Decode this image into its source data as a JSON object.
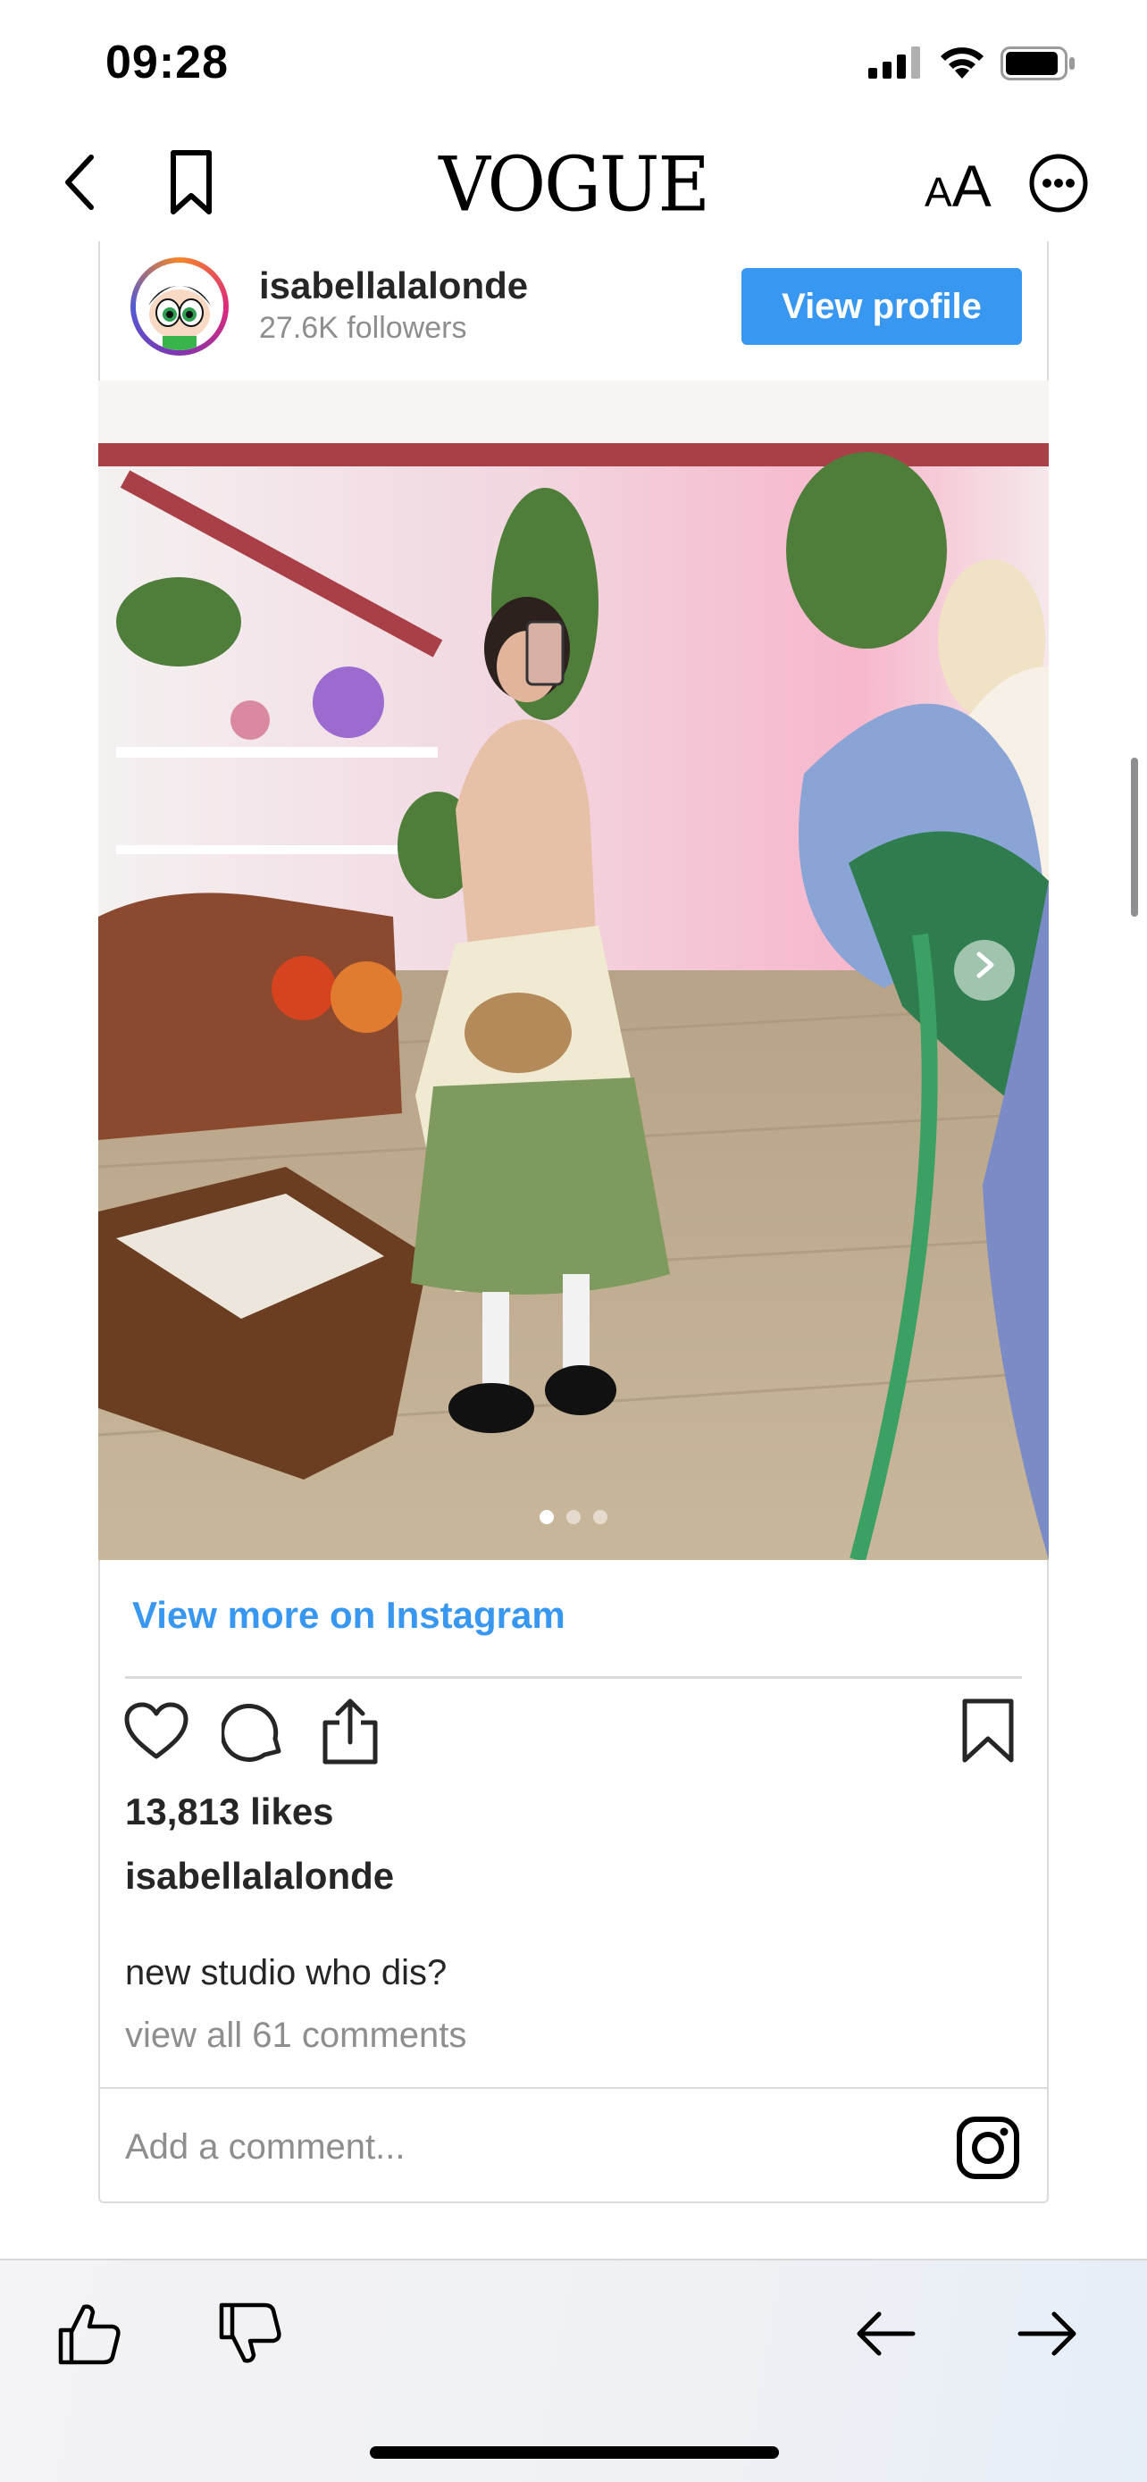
{
  "status_bar": {
    "time": "09:28"
  },
  "nav": {
    "brand": "VOGUE",
    "text_size_small": "A",
    "text_size_big": "A"
  },
  "embed": {
    "username": "isabellalalonde",
    "followers": "27.6K followers",
    "view_profile_label": "View profile",
    "view_more_label": "View more on Instagram",
    "likes": "13,813 likes",
    "caption_user": "isabellalalonde",
    "caption_text": "new studio who dis?",
    "view_comments": "view all 61 comments",
    "comment_placeholder": "Add a comment...",
    "carousel": {
      "count": 3,
      "active": 1
    }
  },
  "colors": {
    "accent": "#3897f0",
    "muted": "#8e8e8e",
    "text": "#262626",
    "border": "#dbdbdb"
  },
  "icons": {
    "nav": [
      "back-icon",
      "bookmark-icon",
      "text-size-icon",
      "more-icon"
    ],
    "post_actions": [
      "heart-icon",
      "comment-icon",
      "share-icon",
      "save-icon"
    ],
    "toolbar": [
      "thumbs-up-icon",
      "thumbs-down-icon",
      "arrow-left-icon",
      "arrow-right-icon"
    ]
  }
}
